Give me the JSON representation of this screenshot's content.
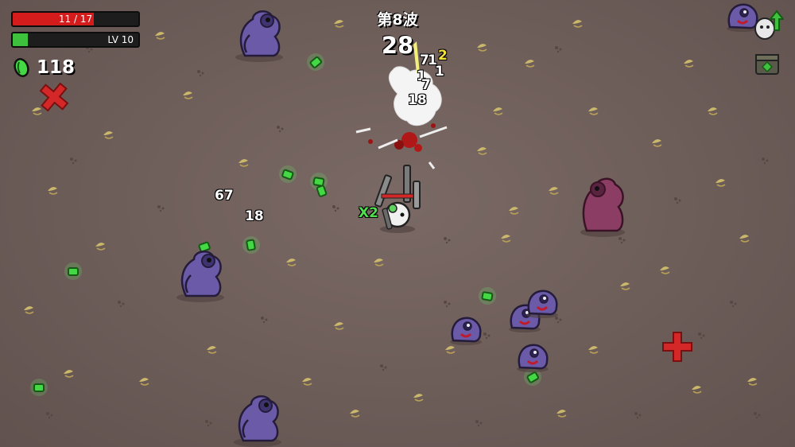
{
  "hud": {
    "hp": {
      "text": "11 / 17",
      "current": 11,
      "max": 17
    },
    "xp": {
      "level_text": "LV 10",
      "fraction": 0.12
    },
    "materials": {
      "count": "118",
      "icon": "material-icon"
    }
  },
  "wave": {
    "label": "第8波",
    "timer": "28"
  },
  "damage_numbers": [
    "7",
    "1",
    "2",
    "1",
    "1",
    "7",
    "18",
    "67",
    "18",
    "X2"
  ],
  "side_icons": [
    "level-up-icon",
    "crate-icon"
  ],
  "colors": {
    "ground": "#6e5e5a",
    "hp": "#d41c1c",
    "xp": "#3ec23e",
    "enemy": "#6a5aa8",
    "material": "#4fe04f"
  }
}
